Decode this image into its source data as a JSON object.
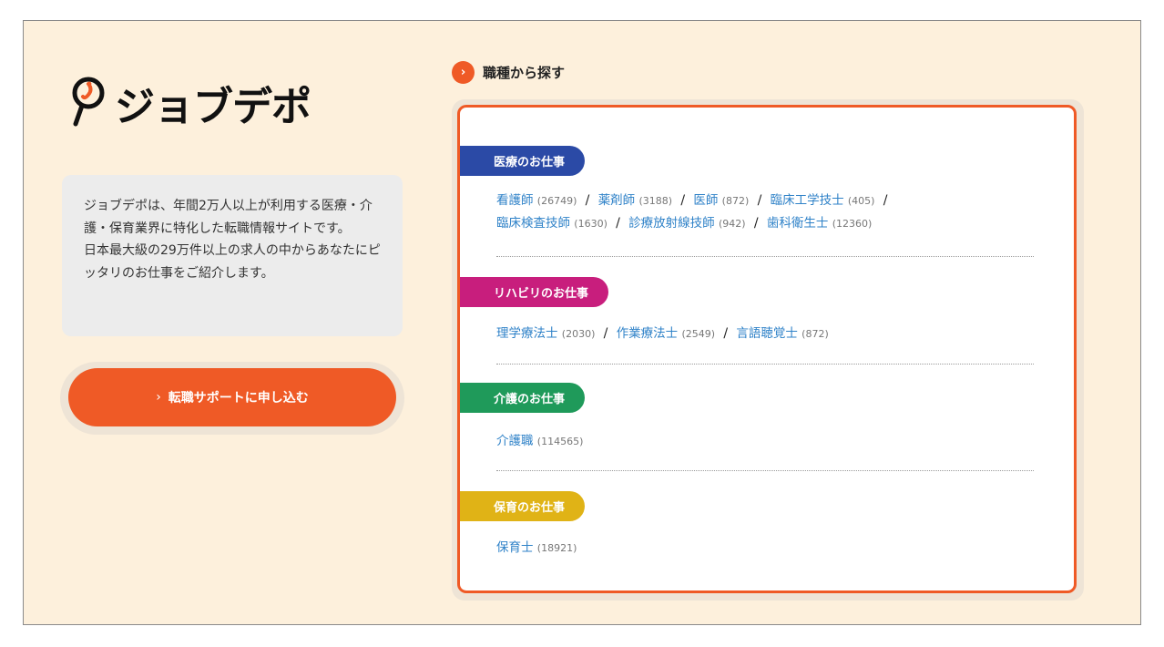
{
  "logo": {
    "text": "ジョブデポ"
  },
  "intro": {
    "text": "ジョブデポは、年間2万人以上が利用する医療・介護・保育業界に特化した転職情報サイトです。\n日本最大級の29万件以上の求人の中からあなたにピッタリのお仕事をご紹介します。"
  },
  "cta": {
    "chevron": "›",
    "label": "転職サポートに申し込む"
  },
  "section": {
    "chevron": "›",
    "title": "職種から探す"
  },
  "categories": [
    {
      "label": "医療のお仕事",
      "color": "#2b4aa6",
      "lines": [
        [
          {
            "name": "看護師",
            "count": "(26749)"
          },
          {
            "name": "薬剤師",
            "count": "(3188)"
          },
          {
            "name": "医師",
            "count": "(872)"
          },
          {
            "name": "臨床工学技士",
            "count": "(405)"
          }
        ],
        [
          {
            "name": "臨床検査技師",
            "count": "(1630)"
          },
          {
            "name": "診療放射線技師",
            "count": "(942)"
          },
          {
            "name": "歯科衛生士",
            "count": "(12360)"
          }
        ]
      ]
    },
    {
      "label": "リハビリのお仕事",
      "color": "#c81e7d",
      "lines": [
        [
          {
            "name": "理学療法士",
            "count": "(2030)"
          },
          {
            "name": "作業療法士",
            "count": "(2549)"
          },
          {
            "name": "言語聴覚士",
            "count": "(872)"
          }
        ]
      ]
    },
    {
      "label": "介護のお仕事",
      "color": "#1f9a5a",
      "lines": [
        [
          {
            "name": "介護職",
            "count": "(114565)"
          }
        ]
      ]
    },
    {
      "label": "保育のお仕事",
      "color": "#e0b316",
      "lines": [
        [
          {
            "name": "保育士",
            "count": "(18921)"
          }
        ]
      ]
    }
  ],
  "separator": "/"
}
